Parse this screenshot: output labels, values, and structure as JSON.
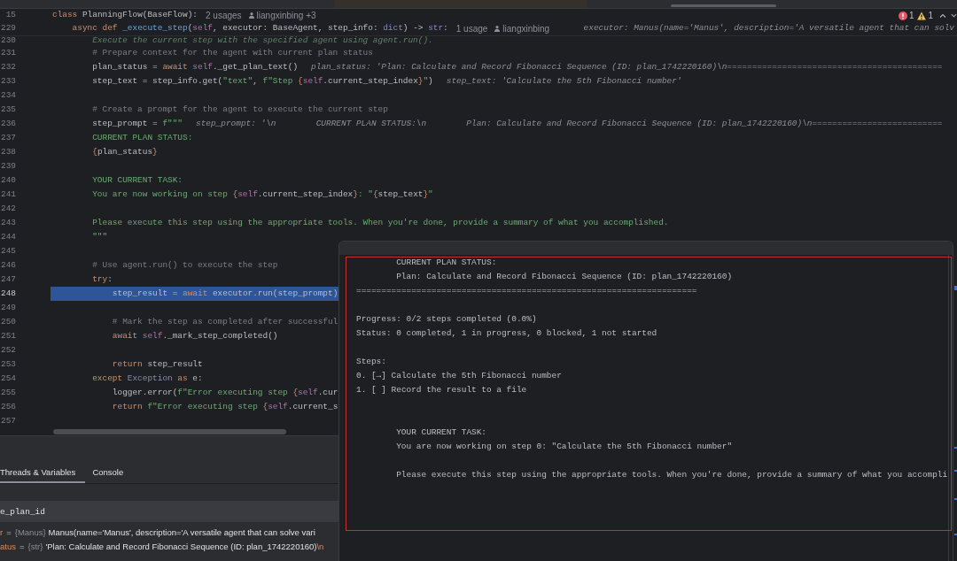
{
  "sticky_header": [
    {
      "number": "15",
      "tokens": [
        {
          "kind": "keyword",
          "text": "class"
        },
        {
          "kind": "plain",
          "text": " PlanningFlow(BaseFlow):"
        }
      ],
      "usages": "2 usages",
      "author": "liangxinbing +3",
      "children": [
        {
          "number": "229",
          "tokens": [
            {
              "kind": "keyword",
              "text": "async"
            },
            {
              "kind": "keyword",
              "text": " def"
            },
            {
              "kind": "function",
              "text": " _execute_step"
            },
            {
              "kind": "plain",
              "text": "("
            },
            {
              "kind": "self",
              "text": "self"
            },
            {
              "kind": "plain",
              "text": ", executor: BaseAgent, step_info: "
            },
            {
              "kind": "builtin",
              "text": "dict"
            },
            {
              "kind": "plain",
              "text": ") -> "
            },
            {
              "kind": "builtin",
              "text": "str"
            },
            {
              "kind": "plain",
              "text": ":"
            }
          ],
          "usages": "1 usage",
          "author": "liangxinbing",
          "inlay": "executor: Manus(name='Manus', description='A versatile agent that can solv"
        }
      ]
    }
  ],
  "inspections": {
    "errors": "1",
    "warnings": "1"
  },
  "editor": {
    "lines": [
      {
        "number": "230",
        "tokens": [
          {
            "kind": "doc",
            "text": "Execute the current step with the specified agent using agent.run()."
          }
        ],
        "current": false
      },
      {
        "number": "231",
        "tokens": [
          {
            "kind": "comment",
            "text": "# Prepare context for the agent with current plan status"
          }
        ],
        "current": false
      },
      {
        "number": "232",
        "tokens": [
          {
            "kind": "plain",
            "text": "plan_status = "
          },
          {
            "kind": "keyword",
            "text": "await"
          },
          {
            "kind": "self",
            "text": " self"
          },
          {
            "kind": "plain",
            "text": "._get_plan_text()"
          }
        ],
        "inlay": "plan_status: 'Plan: Calculate and Record Fibonacci Sequence (ID: plan_1742220160)\\n===========================================",
        "current": false
      },
      {
        "number": "233",
        "tokens": [
          {
            "kind": "plain",
            "text": "step_text = step_info.get("
          },
          {
            "kind": "string",
            "text": "\"text\""
          },
          {
            "kind": "plain",
            "text": ", "
          },
          {
            "kind": "string",
            "text": "f\"Step "
          },
          {
            "kind": "brace",
            "text": "{"
          },
          {
            "kind": "self",
            "text": "self"
          },
          {
            "kind": "plain",
            "text": ".current_step_index"
          },
          {
            "kind": "brace",
            "text": "}"
          },
          {
            "kind": "string",
            "text": "\""
          },
          {
            "kind": "plain",
            "text": ")"
          }
        ],
        "inlay": "step_text: 'Calculate the 5th Fibonacci number'",
        "current": false
      },
      {
        "number": "234",
        "current": false
      },
      {
        "number": "235",
        "tokens": [
          {
            "kind": "comment",
            "text": "# Create a prompt for the agent to execute the current step"
          }
        ],
        "current": false
      },
      {
        "number": "236",
        "tokens": [
          {
            "kind": "plain",
            "text": "step_prompt = "
          },
          {
            "kind": "string",
            "text": "f\"\"\""
          }
        ],
        "inlay": "step_prompt: '\\n        CURRENT PLAN STATUS:\\n        Plan: Calculate and Record Fibonacci Sequence (ID: plan_1742220160)\\n==========================",
        "current": false
      },
      {
        "number": "237",
        "tokens": [
          {
            "kind": "string",
            "text": "CURRENT PLAN STATUS:"
          }
        ],
        "current": false
      },
      {
        "number": "238",
        "tokens": [
          {
            "kind": "brace",
            "text": "{"
          },
          {
            "kind": "plain",
            "text": "plan_status"
          },
          {
            "kind": "brace",
            "text": "}"
          }
        ],
        "current": false
      },
      {
        "number": "239",
        "current": false
      },
      {
        "number": "240",
        "tokens": [
          {
            "kind": "string",
            "text": "YOUR CURRENT TASK:"
          }
        ],
        "current": false
      },
      {
        "number": "241",
        "tokens": [
          {
            "kind": "string",
            "text": "You are now working on step "
          },
          {
            "kind": "brace",
            "text": "{"
          },
          {
            "kind": "self",
            "text": "self"
          },
          {
            "kind": "plain",
            "text": ".current_step_index"
          },
          {
            "kind": "brace",
            "text": "}"
          },
          {
            "kind": "string",
            "text": ": \""
          },
          {
            "kind": "brace",
            "text": "{"
          },
          {
            "kind": "plain",
            "text": "step_text"
          },
          {
            "kind": "brace",
            "text": "}"
          },
          {
            "kind": "string",
            "text": "\""
          }
        ],
        "current": false
      },
      {
        "number": "242",
        "current": false
      },
      {
        "number": "243",
        "tokens": [
          {
            "kind": "string",
            "text": "Please execute this step using the appropriate tools. When you're done, provide a summary of what you accomplished."
          }
        ],
        "current": false
      },
      {
        "number": "244",
        "tokens": [
          {
            "kind": "string",
            "text": "\"\"\""
          }
        ],
        "current": false
      },
      {
        "number": "245",
        "current": false
      },
      {
        "number": "246",
        "tokens": [
          {
            "kind": "comment",
            "text": "# Use agent.run() to execute the step"
          }
        ],
        "current": false
      },
      {
        "number": "247",
        "tokens": [
          {
            "kind": "keyword",
            "text": "try"
          },
          {
            "kind": "plain",
            "text": ":"
          }
        ],
        "current": false,
        "children": [
          {
            "number": "248",
            "tokens": [
              {
                "kind": "plain",
                "text": "step_result = "
              },
              {
                "kind": "keyword",
                "text": "await"
              },
              {
                "kind": "plain",
                "text": " executor.run(step_prompt)"
              }
            ],
            "current": true
          },
          {
            "number": "249",
            "current": false
          },
          {
            "number": "250",
            "tokens": [
              {
                "kind": "comment",
                "text": "# Mark the step as completed after successful"
              }
            ],
            "current": false
          },
          {
            "number": "251",
            "tokens": [
              {
                "kind": "keyword",
                "text": "await"
              },
              {
                "kind": "self",
                "text": " self"
              },
              {
                "kind": "plain",
                "text": "._mark_step_completed()"
              }
            ],
            "current": false
          },
          {
            "number": "252",
            "current": false
          },
          {
            "number": "253",
            "tokens": [
              {
                "kind": "keyword",
                "text": "return"
              },
              {
                "kind": "plain",
                "text": " step_result"
              }
            ],
            "current": false
          }
        ]
      },
      {
        "number": "254",
        "tokens": [
          {
            "kind": "keyword",
            "text": "except"
          },
          {
            "kind": "builtin",
            "text": " Exception"
          },
          {
            "kind": "keyword",
            "text": " as"
          },
          {
            "kind": "plain",
            "text": " e:"
          }
        ],
        "current": false,
        "children": [
          {
            "number": "255",
            "tokens": [
              {
                "kind": "plain",
                "text": "logger.error("
              },
              {
                "kind": "string",
                "text": "f\"Error executing step "
              },
              {
                "kind": "brace",
                "text": "{"
              },
              {
                "kind": "self",
                "text": "self"
              },
              {
                "kind": "plain",
                "text": ".cur"
              }
            ],
            "current": false
          },
          {
            "number": "256",
            "tokens": [
              {
                "kind": "keyword",
                "text": "return"
              },
              {
                "kind": "string",
                "text": " f\"Error executing step "
              },
              {
                "kind": "brace",
                "text": "{"
              },
              {
                "kind": "self",
                "text": "self"
              },
              {
                "kind": "plain",
                "text": ".current_s"
              }
            ],
            "current": false
          }
        ]
      },
      {
        "number": "257",
        "current": false
      }
    ]
  },
  "popup": {
    "lines": [
      {
        "kind": "indented",
        "text": "CURRENT PLAN STATUS:"
      },
      {
        "kind": "indented",
        "text": "Plan: Calculate and Record Fibonacci Sequence (ID: plan_1742220160)"
      },
      {
        "kind": "text",
        "text": "===================================================================="
      },
      {
        "kind": "blank"
      },
      {
        "kind": "text",
        "text": "Progress: 0/2 steps completed (0.0%)"
      },
      {
        "kind": "text",
        "text": "Status: 0 completed, 1 in progress, 0 blocked, 1 not started"
      },
      {
        "kind": "blank"
      },
      {
        "kind": "text",
        "text": "Steps:"
      },
      {
        "kind": "text",
        "text": "0. [→] Calculate the 5th Fibonacci number"
      },
      {
        "kind": "text",
        "text": "1. [ ] Record the result to a file"
      },
      {
        "kind": "blank"
      },
      {
        "kind": "blank"
      },
      {
        "kind": "indented",
        "text": "YOUR CURRENT TASK:"
      },
      {
        "kind": "indented",
        "text": "You are now working on step 0: \"Calculate the 5th Fibonacci number\""
      },
      {
        "kind": "blank"
      },
      {
        "kind": "indented",
        "text": "Please execute this step using the appropriate tools. When you're done, provide a summary of what you accompli"
      }
    ]
  },
  "debug_panel": {
    "tabs": [
      {
        "label": "Threads & Variables",
        "selected": true
      },
      {
        "label": "Console",
        "selected": false
      }
    ],
    "expression": "e_plan_id",
    "variables": [
      {
        "name": "r",
        "separator": "=",
        "type": "{Manus}",
        "value": [
          {
            "kind": "text",
            "text": "Manus(name='Manus', description='A versatile agent that can solve vari"
          }
        ]
      },
      {
        "name": "atus",
        "separator": "=",
        "type": "{str}",
        "value": [
          {
            "kind": "text",
            "text": "'Plan: Calculate and Record Fibonacci Sequence (ID: plan_1742220160)"
          },
          {
            "kind": "escape",
            "text": "\\n"
          }
        ]
      }
    ]
  }
}
